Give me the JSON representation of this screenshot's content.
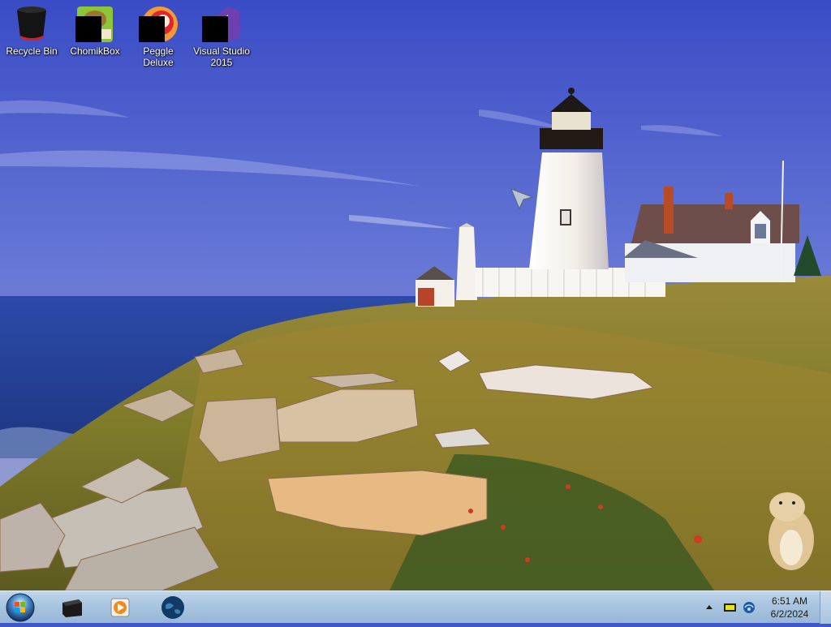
{
  "desktop_icons": [
    {
      "label": "Recycle Bin",
      "icon": "recycle-bin-icon"
    },
    {
      "label": "ChomikBox",
      "icon": "chomikbox-icon"
    },
    {
      "label": "Peggle Deluxe",
      "icon": "peggle-icon"
    },
    {
      "label": "Visual Studio 2015",
      "icon": "visual-studio-icon"
    }
  ],
  "taskbar": {
    "pinned": [
      {
        "icon": "start-orb-icon"
      },
      {
        "icon": "black-box-app-icon"
      },
      {
        "icon": "media-player-icon"
      },
      {
        "icon": "globe-app-icon"
      }
    ]
  },
  "tray": {
    "clock_time": "6:51 AM",
    "clock_date": "6/2/2024",
    "icons": [
      "show-hidden-icons-icon",
      "battery-icon",
      "network-icon"
    ]
  },
  "colors": {
    "taskbar": "#a8c4e0",
    "sky_top": "#3b4fc6",
    "sea": "#23429a",
    "grass": "#8e8a2f"
  }
}
